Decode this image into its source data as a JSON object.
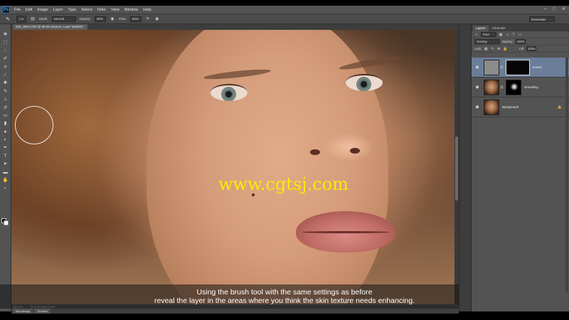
{
  "app": {
    "logo": "Ps",
    "menu": [
      "File",
      "Edit",
      "Image",
      "Layer",
      "Type",
      "Select",
      "Filter",
      "View",
      "Window",
      "Help"
    ],
    "window_controls": [
      "–",
      "□",
      "✕"
    ]
  },
  "options_bar": {
    "preset_value": "175",
    "mode_label": "Mode:",
    "mode_value": "Normal",
    "opacity_label": "Opacity:",
    "opacity_value": "50%",
    "flow_label": "Flow:",
    "flow_value": "50%",
    "workspace": "Essentials"
  },
  "document": {
    "tab_title": "IMG_9624.CR2 @ 86.9% (texture, Layer Mask/8) *",
    "watermark": "www.cgtsj.com"
  },
  "status": {
    "zoom": "86.87%",
    "doc_size": "Doc: 51.3M/102.9M"
  },
  "bottom_tabs": [
    "Mini Bridge",
    "Timeline"
  ],
  "subtitle": {
    "line1": "Using the brush tool with the same settings as before",
    "line2": "reveal the layer in the areas where you think the skin texture needs enhancing."
  },
  "layers_panel": {
    "tabs": [
      "Layers",
      "Channels"
    ],
    "kind_label": "Kind",
    "blend_mode": "Overlay",
    "opacity_label": "Opacity:",
    "opacity_value": "100%",
    "lock_label": "Lock:",
    "fill_label": "Fill:",
    "fill_value": "100%",
    "layers": [
      {
        "name": "texture",
        "selected": true
      },
      {
        "name": "smoothing",
        "selected": false
      },
      {
        "name": "Background",
        "selected": false
      }
    ]
  },
  "colors": {
    "ui_dark": "#535353",
    "selected_layer": "#6a7d99",
    "watermark": "#ffea00"
  }
}
